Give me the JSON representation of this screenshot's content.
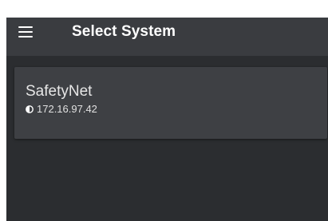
{
  "header": {
    "title": "Select System",
    "menu_icon": "hamburger-menu-icon"
  },
  "systems": [
    {
      "name": "SafetyNet",
      "ip": "172.16.97.42",
      "status_icon": "half-circle-icon"
    }
  ],
  "colors": {
    "background": "#2b2d30",
    "header": "#3a3c40",
    "card": "#3e4044",
    "text": "#ffffff"
  }
}
